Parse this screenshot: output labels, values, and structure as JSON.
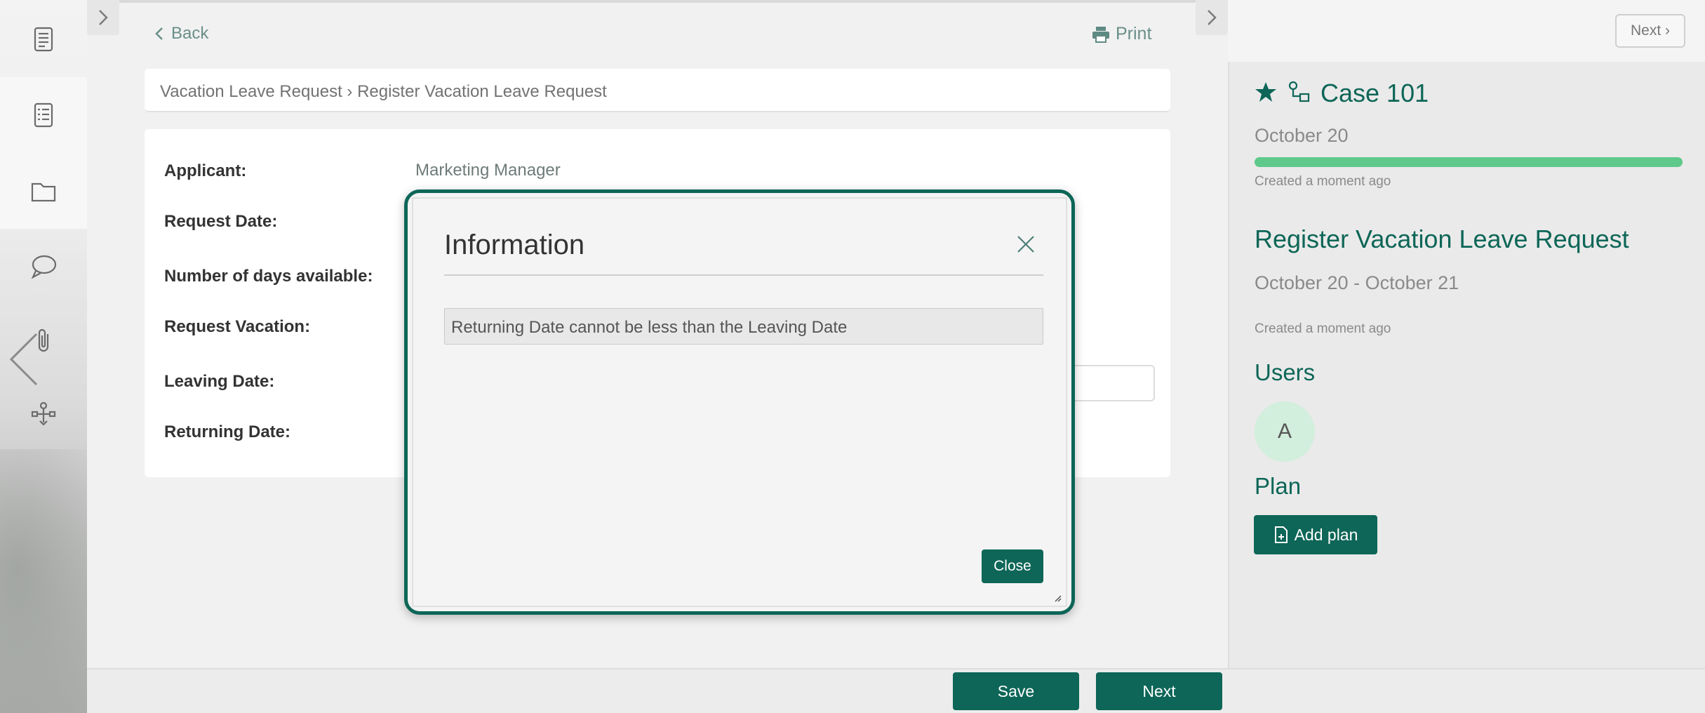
{
  "nav": {
    "back_label": "Back",
    "print_label": "Print"
  },
  "breadcrumb": "Vacation Leave Request › Register Vacation Leave Request",
  "form": {
    "fields": [
      {
        "label": "Applicant:",
        "value": "Marketing Manager"
      },
      {
        "label": "Request Date:",
        "value": ""
      },
      {
        "label": "Number of days available:",
        "value": ""
      },
      {
        "label": "Request Vacation:",
        "value": ""
      },
      {
        "label": "Leaving Date:",
        "value": ""
      },
      {
        "label": "Returning Date:",
        "value": ""
      }
    ]
  },
  "modal": {
    "title": "Information",
    "message": "Returning Date cannot be less than the Leaving Date",
    "close_button": "Close"
  },
  "footer": {
    "save_label": "Save",
    "next_label": "Next"
  },
  "right_panel": {
    "next_top_label": "Next ›",
    "case_title": "Case 101",
    "case_date": "October 20",
    "case_created": "Created a moment ago",
    "progress": 1.0,
    "task_title": "Register Vacation Leave Request",
    "task_dates": "October 20 - October 21",
    "task_created": "Created a moment ago",
    "users_heading": "Users",
    "user_avatar_initial": "A",
    "plan_heading": "Plan",
    "add_plan_label": "Add plan"
  },
  "colors": {
    "accent": "#0d6657",
    "progress": "#5ec98a",
    "link": "#6a8f88"
  },
  "icons": {
    "rail": [
      "document-icon",
      "list-document-icon",
      "folder-icon",
      "chat-bubble-icon",
      "paperclip-icon",
      "process-map-icon"
    ]
  }
}
